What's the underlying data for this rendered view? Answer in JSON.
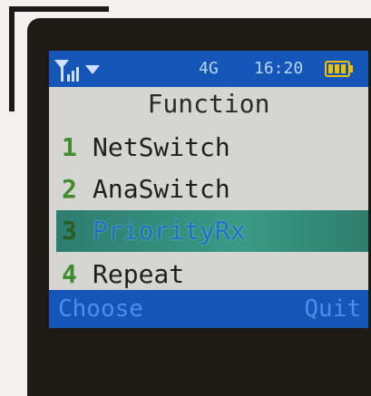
{
  "status_bar": {
    "signal_icon": "signal-strength-icon",
    "network_type": "4G",
    "time": "16:20",
    "battery_icon": "battery-icon"
  },
  "menu": {
    "title": "Function",
    "items": [
      {
        "number": "1",
        "label": "NetSwitch",
        "selected": false
      },
      {
        "number": "2",
        "label": "AnaSwitch",
        "selected": false
      },
      {
        "number": "3",
        "label": "PriorityRx",
        "selected": true
      },
      {
        "number": "4",
        "label": "Repeat",
        "selected": false
      }
    ]
  },
  "softkeys": {
    "left": "Choose",
    "right": "Quit"
  },
  "colors": {
    "status_bar_bg": "#1455b8",
    "selection_bg": "#3a9a86",
    "screen_bg": "#d5d6d2"
  }
}
